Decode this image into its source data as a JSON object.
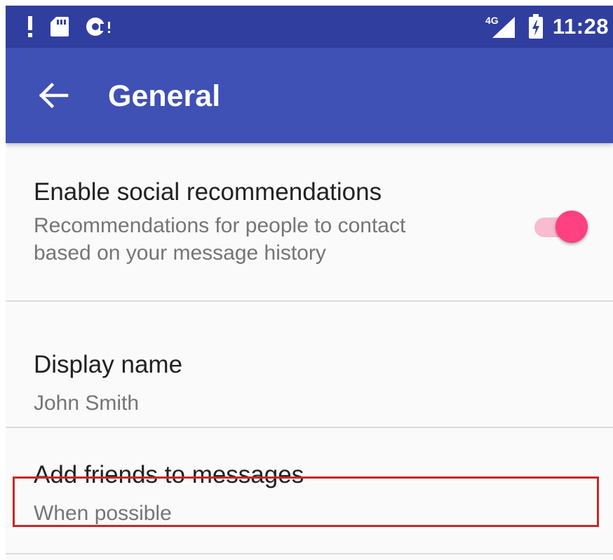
{
  "status_bar": {
    "time": "11:28",
    "network_label": "4G",
    "icons": [
      "alert-icon",
      "sd-card-icon",
      "sync-icon",
      "cell-signal-icon",
      "battery-charging-icon"
    ]
  },
  "app_bar": {
    "title": "General",
    "back_icon": "arrow-back-icon"
  },
  "preferences": [
    {
      "title": "Enable social recommendations",
      "summary_lines": [
        "Recommendations for people to contact",
        "based on your message history"
      ],
      "toggle_on": true
    },
    {
      "title": "Display name",
      "summary": "John Smith"
    },
    {
      "title": "Add friends to messages",
      "summary": "When possible"
    }
  ],
  "colors": {
    "status_bar": "#303f9f",
    "app_bar": "#3f51b5",
    "accent": "#ff4081",
    "accent_track": "#f8bbd0",
    "highlight": "#c62828"
  }
}
